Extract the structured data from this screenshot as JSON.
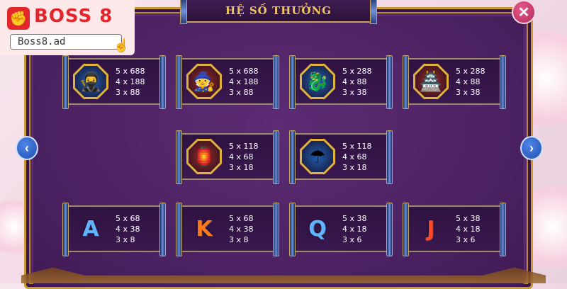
{
  "logo": {
    "brand": "BOSS 8",
    "domain": "Boss8.ad"
  },
  "title": "HỆ SỐ THƯỞNG",
  "close_label": "✕",
  "nav": {
    "prev": "‹",
    "next": "›"
  },
  "symbols": [
    {
      "id": "samurai",
      "icon": "🥷",
      "icon_name": "samurai-portrait-icon",
      "bg": "#1f5fb0",
      "pays": [
        "5 x 688",
        "4 x 188",
        "3 x 88"
      ]
    },
    {
      "id": "elder",
      "icon": "🧙",
      "icon_name": "elder-warrior-icon",
      "bg": "#9a2d25",
      "pays": [
        "5 x 688",
        "4 x 188",
        "3 x 88"
      ]
    },
    {
      "id": "dragon",
      "icon": "🐉",
      "icon_name": "green-dragon-icon",
      "bg": "#1f5fb0",
      "pays": [
        "5 x 288",
        "4 x 88",
        "3 x 38"
      ]
    },
    {
      "id": "pagoda",
      "icon": "🏯",
      "icon_name": "pagoda-icon",
      "bg": "#9a2d25",
      "pays": [
        "5 x 288",
        "4 x 88",
        "3 x 38"
      ]
    },
    {
      "id": "lantern",
      "icon": "🏮",
      "icon_name": "red-lantern-icon",
      "bg": "#9a2d25",
      "pays": [
        "5 x 118",
        "4 x 68",
        "3 x 18"
      ]
    },
    {
      "id": "umbrella",
      "icon": "☂",
      "icon_name": "red-umbrella-icon",
      "bg": "#1f5fb0",
      "pays": [
        "5 x 118",
        "4 x 68",
        "3 x 18"
      ]
    },
    {
      "id": "A",
      "icon": "A",
      "icon_name": "letter-a-icon",
      "color": "#5fb3ff",
      "pays": [
        "5 x 68",
        "4 x 38",
        "3 x 8"
      ]
    },
    {
      "id": "K",
      "icon": "K",
      "icon_name": "letter-k-icon",
      "color": "#ff7a1f",
      "pays": [
        "5 x 68",
        "4 x 38",
        "3 x 8"
      ]
    },
    {
      "id": "Q",
      "icon": "Q",
      "icon_name": "letter-q-icon",
      "color": "#5fb3ff",
      "pays": [
        "5 x 38",
        "4 x 18",
        "3 x 6"
      ]
    },
    {
      "id": "J",
      "icon": "J",
      "icon_name": "letter-j-icon",
      "color": "#ff4a2a",
      "pays": [
        "5 x 38",
        "4 x 18",
        "3 x 6"
      ]
    }
  ]
}
